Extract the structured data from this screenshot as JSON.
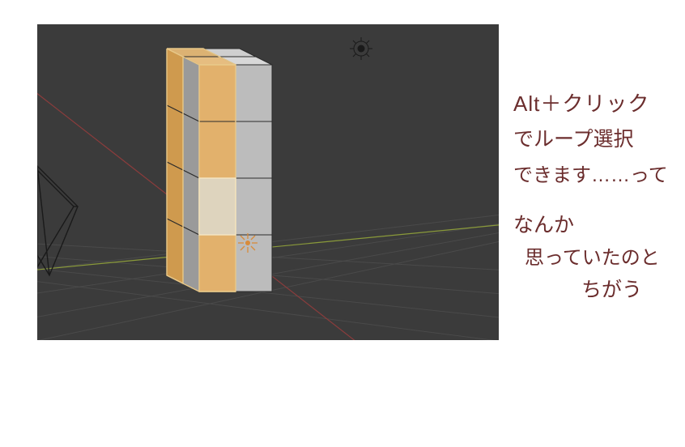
{
  "viewport": {
    "grid_color": "#4a4a4a",
    "axis_x_color": "#a04646",
    "axis_y_color": "#7d9a3a",
    "face_unselected": "#b8b8b8",
    "face_selected": "#e2b16c",
    "face_active": "#d9d1bf",
    "edge_color": "#303030",
    "edge_selected": "#e8c888",
    "wire_color": "#1a1a1a",
    "cursor_color": "#d88b3b"
  },
  "notes": {
    "line1": "Alt＋クリック",
    "line2": "でループ選択",
    "line3": "できます……って",
    "line4": "なんか",
    "line5": "思っていたのと",
    "line6": "ちがう"
  }
}
